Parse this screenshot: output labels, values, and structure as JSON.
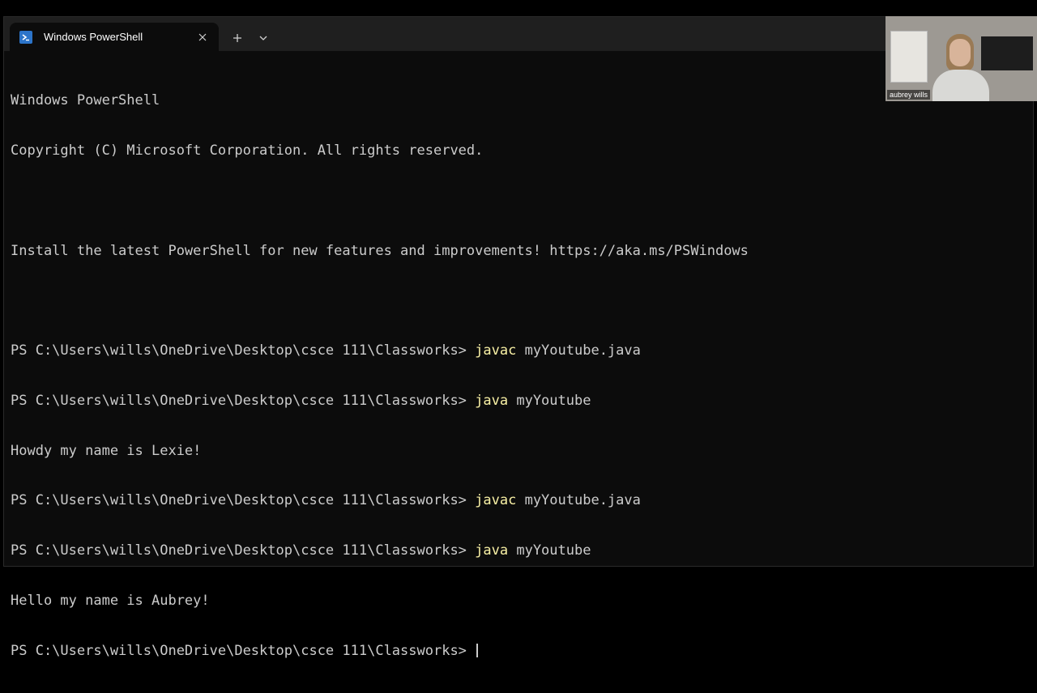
{
  "window": {
    "tab_title": "Windows PowerShell",
    "icons": {
      "tab": "powershell-icon",
      "close": "close-icon",
      "new_tab": "plus-icon",
      "dropdown": "chevron-down-icon"
    }
  },
  "terminal": {
    "lines": [
      {
        "text": "Windows PowerShell"
      },
      {
        "text": "Copyright (C) Microsoft Corporation. All rights reserved."
      },
      {
        "text": ""
      },
      {
        "text": "Install the latest PowerShell for new features and improvements! https://aka.ms/PSWindows"
      },
      {
        "text": ""
      },
      {
        "prompt": "PS C:\\Users\\wills\\OneDrive\\Desktop\\csce 111\\Classworks> ",
        "cmd": "javac",
        "args": " myYoutube.java"
      },
      {
        "prompt": "PS C:\\Users\\wills\\OneDrive\\Desktop\\csce 111\\Classworks> ",
        "cmd": "java",
        "args": " myYoutube"
      },
      {
        "text": "Howdy my name is Lexie!"
      },
      {
        "prompt": "PS C:\\Users\\wills\\OneDrive\\Desktop\\csce 111\\Classworks> ",
        "cmd": "javac",
        "args": " myYoutube.java"
      },
      {
        "prompt": "PS C:\\Users\\wills\\OneDrive\\Desktop\\csce 111\\Classworks> ",
        "cmd": "java",
        "args": " myYoutube"
      },
      {
        "text": "Hello my name is Aubrey!"
      },
      {
        "prompt": "PS C:\\Users\\wills\\OneDrive\\Desktop\\csce 111\\Classworks> ",
        "cursor": true
      }
    ]
  },
  "video": {
    "participant_name": "aubrey wills"
  },
  "colors": {
    "terminal_bg": "#0c0c0c",
    "terminal_fg": "#cccccc",
    "command": "#f9f1a5",
    "titlebar": "#1f1f1f",
    "tab_icon": "#2c74c9"
  }
}
